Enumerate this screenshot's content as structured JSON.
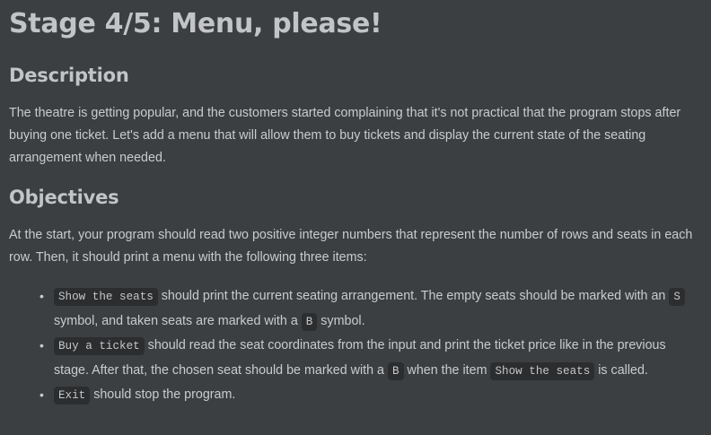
{
  "title": "Stage 4/5: Menu, please!",
  "description": {
    "heading": "Description",
    "text": "The theatre is getting popular, and the customers started complaining that it's not practical that the program stops after buying one ticket. Let's add a menu that will allow them to buy tickets and display the current state of the seating arrangement when needed."
  },
  "objectives": {
    "heading": "Objectives",
    "intro": "At the start, your program should read two positive integer numbers that represent the number of rows and seats in each row. Then, it should print a menu with the following three items:",
    "items": [
      {
        "code": "Show the seats",
        "t1": " should print the current seating arrangement. The empty seats should be marked with an ",
        "code2": "S",
        "t2": " symbol, and taken seats are marked with a ",
        "code3": "B",
        "t3": " symbol."
      },
      {
        "code": "Buy a ticket",
        "t1": " should read the seat coordinates from the input and print the ticket price like in the previous stage. After that, the chosen seat should be marked with a ",
        "code2": "B",
        "t2": " when the item ",
        "code3": "Show the seats",
        "t3": " is called."
      },
      {
        "code": "Exit",
        "t1": " should stop the program."
      }
    ]
  }
}
